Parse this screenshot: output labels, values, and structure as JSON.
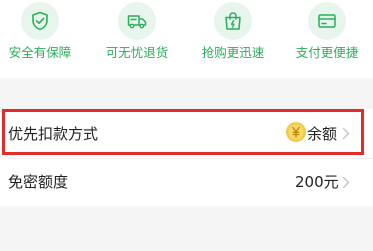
{
  "features": [
    {
      "label": "安全有保障",
      "icon": "shield-check-icon"
    },
    {
      "label": "可无忧退货",
      "icon": "delivery-truck-icon"
    },
    {
      "label": "抢购更迅速",
      "icon": "shopping-bag-icon"
    },
    {
      "label": "支付更便捷",
      "icon": "credit-card-icon"
    }
  ],
  "payment_method": {
    "title": "优先扣款方式",
    "value": "余额",
    "icon": "coin-yen-icon"
  },
  "quota": {
    "title": "免密额度",
    "value": "200元"
  },
  "colors": {
    "accent_green": "#2aae5b",
    "highlight_red": "#e32b2b",
    "coin_gold": "#f2c94c"
  }
}
